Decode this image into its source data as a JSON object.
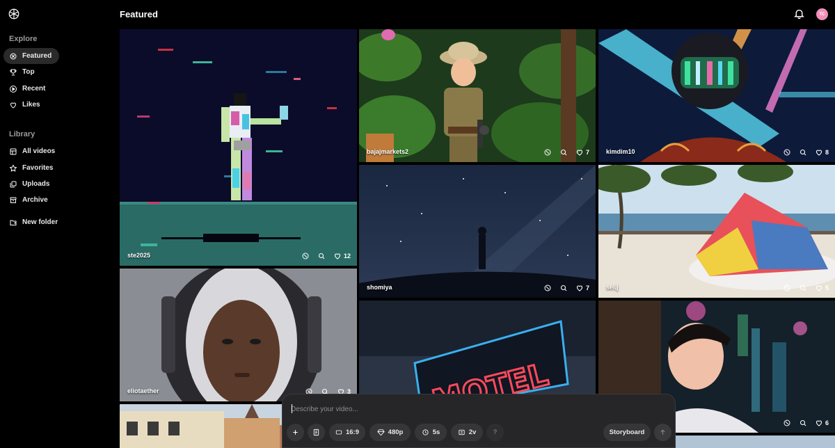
{
  "page": {
    "title": "Featured"
  },
  "header": {
    "avatar_initials": "TC"
  },
  "sidebar": {
    "explore_title": "Explore",
    "explore": [
      {
        "label": "Featured",
        "icon": "featured-icon",
        "active": true
      },
      {
        "label": "Top",
        "icon": "trophy-icon"
      },
      {
        "label": "Recent",
        "icon": "play-circle-icon"
      },
      {
        "label": "Likes",
        "icon": "heart-icon"
      }
    ],
    "library_title": "Library",
    "library": [
      {
        "label": "All videos",
        "icon": "grid-icon"
      },
      {
        "label": "Favorites",
        "icon": "star-icon"
      },
      {
        "label": "Uploads",
        "icon": "uploads-icon"
      },
      {
        "label": "Archive",
        "icon": "archive-icon"
      }
    ],
    "new_folder": {
      "label": "New folder",
      "icon": "new-folder-icon"
    }
  },
  "tiles": [
    {
      "user": "ste2025",
      "likes": "12"
    },
    {
      "user": "bajajmarkets2",
      "likes": "7"
    },
    {
      "user": "kimdim10",
      "likes": "8"
    },
    {
      "user": "shomiya",
      "likes": "7"
    },
    {
      "user": "sei.j",
      "likes": "5"
    },
    {
      "user": "eliotaether",
      "likes": "3"
    },
    {
      "user": "",
      "likes": ""
    },
    {
      "user": "",
      "likes": "6"
    }
  ],
  "composer": {
    "placeholder": "Describe your video...",
    "aspect": "16:9",
    "resolution": "480p",
    "duration": "5s",
    "variations": "2v",
    "help": "?",
    "storyboard": "Storyboard"
  },
  "colors": {
    "accent_avatar": "#f090b8",
    "surface": "#262628"
  }
}
